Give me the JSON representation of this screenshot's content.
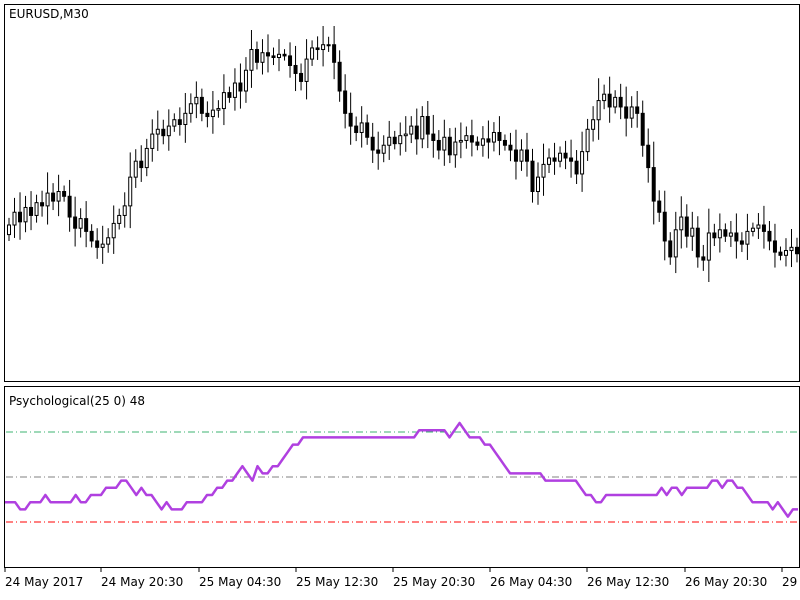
{
  "chart_data": [
    {
      "type": "candlestick",
      "title": "EURUSD,M30",
      "grid": false,
      "colors": {
        "candle": "#000000",
        "background": "#ffffff",
        "frame": "#000000"
      },
      "close": [
        1.12,
        1.1208,
        1.1202,
        1.1211,
        1.1206,
        1.1214,
        1.1212,
        1.122,
        1.1215,
        1.1221,
        1.1218,
        1.1205,
        1.1198,
        1.1204,
        1.1196,
        1.119,
        1.1186,
        1.1188,
        1.1192,
        1.1201,
        1.1206,
        1.1212,
        1.123,
        1.124,
        1.1236,
        1.1248,
        1.1257,
        1.126,
        1.1256,
        1.1262,
        1.1266,
        1.1263,
        1.127,
        1.1276,
        1.128,
        1.127,
        1.1268,
        1.1272,
        1.1273,
        1.1283,
        1.128,
        1.1289,
        1.1284,
        1.1297,
        1.131,
        1.1302,
        1.1308,
        1.1306,
        1.1305,
        1.1307,
        1.1306,
        1.13,
        1.1295,
        1.129,
        1.1304,
        1.1311,
        1.131,
        1.1313,
        1.1313,
        1.1302,
        1.1284,
        1.127,
        1.1262,
        1.1258,
        1.1264,
        1.1255,
        1.1247,
        1.1245,
        1.125,
        1.1255,
        1.1251,
        1.1256,
        1.1257,
        1.1262,
        1.1254,
        1.1268,
        1.1257,
        1.1253,
        1.1247,
        1.1255,
        1.1244,
        1.1252,
        1.1253,
        1.1256,
        1.1252,
        1.125,
        1.1254,
        1.1252,
        1.1258,
        1.1253,
        1.125,
        1.1247,
        1.124,
        1.1247,
        1.124,
        1.1221,
        1.123,
        1.1238,
        1.1242,
        1.124,
        1.1245,
        1.1242,
        1.124,
        1.1232,
        1.1246,
        1.126,
        1.1266,
        1.1278,
        1.1282,
        1.1274,
        1.128,
        1.1274,
        1.1267,
        1.1274,
        1.127,
        1.125,
        1.1236,
        1.1215,
        1.1208,
        1.119,
        1.118,
        1.1197,
        1.1205,
        1.1193,
        1.1198,
        1.118,
        1.1178,
        1.1195,
        1.1192,
        1.1197,
        1.1193,
        1.1195,
        1.119,
        1.1188,
        1.1196,
        1.1198,
        1.12,
        1.1196,
        1.119,
        1.1183,
        1.1181,
        1.1184,
        1.1186,
        1.1182
      ],
      "x_labels": [
        "24 May 2017",
        "24 May 20:30",
        "25 May 04:30",
        "25 May 12:30",
        "25 May 20:30",
        "26 May 04:30",
        "26 May 12:30",
        "26 May 20:30",
        "29"
      ]
    },
    {
      "type": "line",
      "label": "Psychological(25 0) 48",
      "ylim": [
        0,
        100
      ],
      "levels": [
        {
          "value": 75,
          "color": "#3cb371"
        },
        {
          "value": 50,
          "color": "#808080"
        },
        {
          "value": 25,
          "color": "#ff0000"
        }
      ],
      "series": [
        {
          "color": "#b040e0",
          "values": [
            36,
            36,
            36,
            32,
            32,
            36,
            36,
            36,
            40,
            36,
            36,
            36,
            36,
            36,
            40,
            36,
            36,
            40,
            40,
            40,
            44,
            44,
            44,
            48,
            48,
            44,
            40,
            44,
            40,
            40,
            36,
            32,
            36,
            32,
            32,
            32,
            36,
            36,
            36,
            36,
            40,
            40,
            44,
            44,
            48,
            48,
            52,
            56,
            52,
            48,
            56,
            52,
            52,
            56,
            56,
            60,
            64,
            68,
            68,
            72,
            72,
            72,
            72,
            72,
            72,
            72,
            72,
            72,
            72,
            72,
            72,
            72,
            72,
            72,
            72,
            72,
            72,
            72,
            72,
            72,
            72,
            72,
            76,
            76,
            76,
            76,
            76,
            76,
            72,
            76,
            80,
            76,
            72,
            72,
            72,
            68,
            68,
            64,
            60,
            56,
            52,
            52,
            52,
            52,
            52,
            52,
            52,
            48,
            48,
            48,
            48,
            48,
            48,
            48,
            44,
            40,
            40,
            36,
            36,
            40,
            40,
            40,
            40,
            40,
            40,
            40,
            40,
            40,
            40,
            40,
            44,
            40,
            44,
            44,
            40,
            44,
            44,
            44,
            44,
            44,
            48,
            48,
            44,
            48,
            48,
            44,
            44,
            40,
            36,
            36,
            36,
            36,
            32,
            36,
            32,
            28,
            32,
            32
          ]
        }
      ]
    }
  ]
}
